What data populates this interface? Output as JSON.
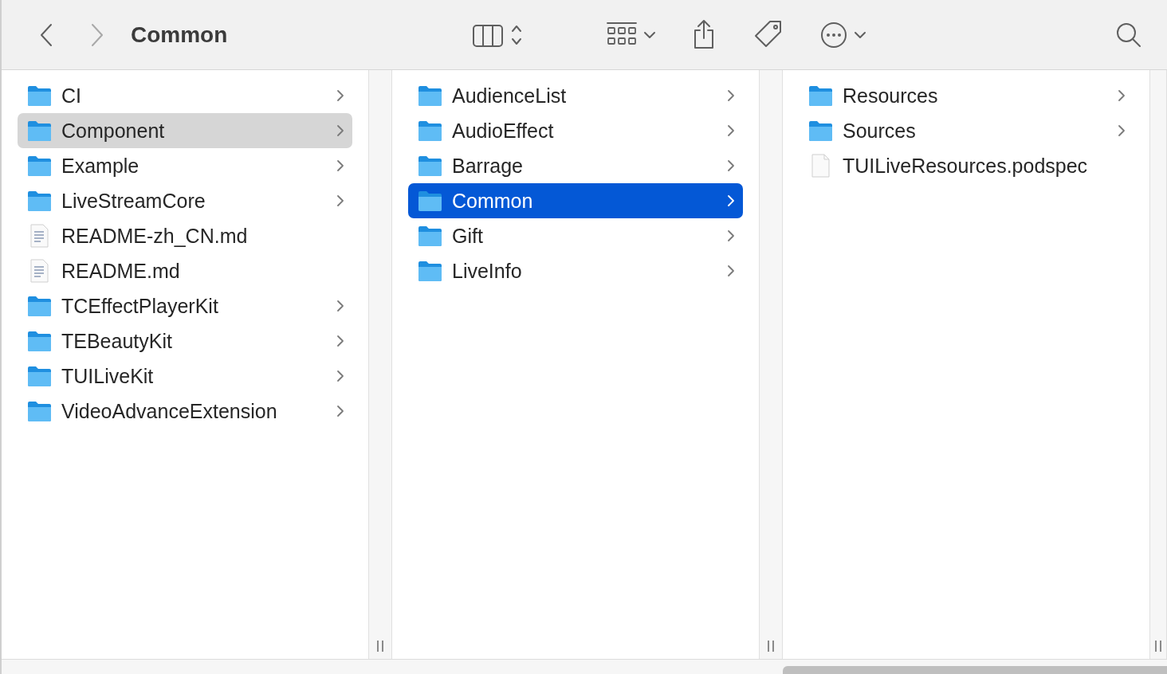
{
  "window": {
    "title": "Common"
  },
  "columns": [
    {
      "items": [
        {
          "name": "CI",
          "kind": "folder",
          "selected": false
        },
        {
          "name": "Component",
          "kind": "folder",
          "selected": true
        },
        {
          "name": "Example",
          "kind": "folder",
          "selected": false
        },
        {
          "name": "LiveStreamCore",
          "kind": "folder",
          "selected": false
        },
        {
          "name": "README-zh_CN.md",
          "kind": "text-file",
          "selected": false
        },
        {
          "name": "README.md",
          "kind": "text-file",
          "selected": false
        },
        {
          "name": "TCEffectPlayerKit",
          "kind": "folder",
          "selected": false
        },
        {
          "name": "TEBeautyKit",
          "kind": "folder",
          "selected": false
        },
        {
          "name": "TUILiveKit",
          "kind": "folder",
          "selected": false
        },
        {
          "name": "VideoAdvanceExtension",
          "kind": "folder",
          "selected": false
        }
      ]
    },
    {
      "items": [
        {
          "name": "AudienceList",
          "kind": "folder",
          "selected": false
        },
        {
          "name": "AudioEffect",
          "kind": "folder",
          "selected": false
        },
        {
          "name": "Barrage",
          "kind": "folder",
          "selected": false
        },
        {
          "name": "Common",
          "kind": "folder",
          "selected": true
        },
        {
          "name": "Gift",
          "kind": "folder",
          "selected": false
        },
        {
          "name": "LiveInfo",
          "kind": "folder",
          "selected": false
        }
      ]
    },
    {
      "items": [
        {
          "name": "Resources",
          "kind": "folder",
          "selected": false
        },
        {
          "name": "Sources",
          "kind": "folder",
          "selected": false
        },
        {
          "name": "TUILiveResources.podspec",
          "kind": "blank-file",
          "selected": false
        }
      ]
    }
  ]
}
